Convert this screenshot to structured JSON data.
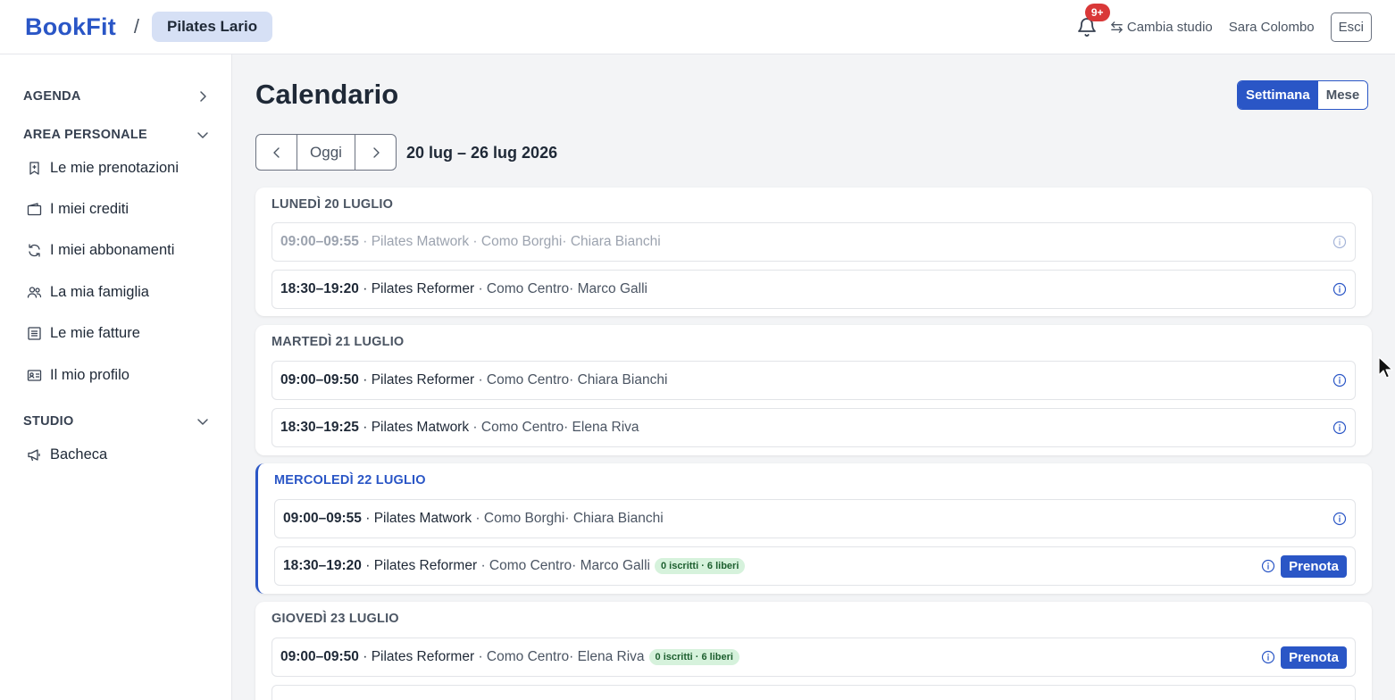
{
  "header": {
    "brand": "BookFit",
    "separator": "/",
    "studio": "Pilates Lario",
    "notifications_badge": "9+",
    "switch_studio": "Cambia studio",
    "user_name": "Sara Colombo",
    "logout": "Esci"
  },
  "sidebar": {
    "sections": [
      {
        "label": "AGENDA",
        "state": "collapsed"
      },
      {
        "label": "AREA PERSONALE",
        "state": "expanded"
      },
      {
        "label": "STUDIO",
        "state": "expanded"
      }
    ],
    "personal_items": [
      {
        "label": "Le mie prenotazioni",
        "icon": "bookmark-icon"
      },
      {
        "label": "I miei crediti",
        "icon": "wallet-icon"
      },
      {
        "label": "I miei abbonamenti",
        "icon": "refresh-icon"
      },
      {
        "label": "La mia famiglia",
        "icon": "users-icon"
      },
      {
        "label": "Le mie fatture",
        "icon": "receipt-icon"
      },
      {
        "label": "Il mio profilo",
        "icon": "id-card-icon"
      }
    ],
    "studio_items": [
      {
        "label": "Bacheca",
        "icon": "megaphone-icon"
      }
    ]
  },
  "main": {
    "title": "Calendario",
    "view_toggle": {
      "week": "Settimana",
      "month": "Mese",
      "active": "week"
    },
    "nav": {
      "today": "Oggi"
    },
    "date_range": "20 lug – 26 lug 2026",
    "accent_color": "#2a56c6",
    "days": [
      {
        "title": "LUNEDÌ 20 LUGLIO",
        "sessions": [
          {
            "time": "09:00–09:55",
            "class": "Pilates Matwork",
            "location": "Como Borghi",
            "instructor": "Chiara Bianchi",
            "past": true
          },
          {
            "time": "18:30–19:20",
            "class": "Pilates Reformer",
            "location": "Como Centro",
            "instructor": "Marco Galli"
          }
        ]
      },
      {
        "title": "MARTEDÌ 21 LUGLIO",
        "sessions": [
          {
            "time": "09:00–09:50",
            "class": "Pilates Reformer",
            "location": "Como Centro",
            "instructor": "Chiara Bianchi"
          },
          {
            "time": "18:30–19:25",
            "class": "Pilates Matwork",
            "location": "Como Centro",
            "instructor": "Elena Riva"
          }
        ]
      },
      {
        "title": "MERCOLEDÌ 22 LUGLIO",
        "today": true,
        "sessions": [
          {
            "time": "09:00–09:55",
            "class": "Pilates Matwork",
            "location": "Como Borghi",
            "instructor": "Chiara Bianchi"
          },
          {
            "time": "18:30–19:20",
            "class": "Pilates Reformer",
            "location": "Como Centro",
            "instructor": "Marco Galli",
            "spots": "0 iscritti · 6 liberi",
            "book": "Prenota"
          }
        ]
      },
      {
        "title": "GIOVEDÌ 23 LUGLIO",
        "sessions": [
          {
            "time": "09:00–09:50",
            "class": "Pilates Reformer",
            "location": "Como Centro",
            "instructor": "Elena Riva",
            "spots": "0 iscritti · 6 liberi",
            "book": "Prenota"
          }
        ]
      }
    ]
  }
}
